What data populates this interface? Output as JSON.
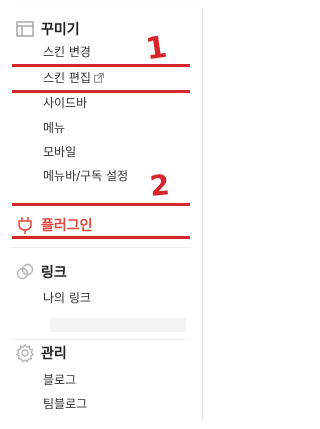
{
  "sections": [
    {
      "id": "customize",
      "icon": "layout-icon",
      "title": "꾸미기",
      "items": [
        {
          "label": "스킨 변경",
          "external": false
        },
        {
          "label": "스킨 편집",
          "external": true
        },
        {
          "label": "사이드바",
          "external": false
        },
        {
          "label": "메뉴",
          "external": false
        },
        {
          "label": "모바일",
          "external": false
        },
        {
          "label": "메뉴바/구독 설정",
          "external": false
        }
      ]
    },
    {
      "id": "plugin",
      "icon": "plug-icon",
      "title": "플러그인",
      "active": true,
      "items": []
    },
    {
      "id": "link",
      "icon": "link-icon",
      "title": "링크",
      "items": [
        {
          "label": "나의 링크",
          "external": false
        }
      ]
    },
    {
      "id": "manage",
      "icon": "gear-icon",
      "title": "관리",
      "items": [
        {
          "label": "블로그",
          "external": false
        },
        {
          "label": "팀블로그",
          "external": false
        }
      ]
    }
  ],
  "annotations": {
    "mark_1": "1",
    "mark_2": "2"
  },
  "colors": {
    "active": "#e2473b",
    "annotation": "#d7262b",
    "text": "#333333",
    "icon": "#9a9a9a"
  }
}
